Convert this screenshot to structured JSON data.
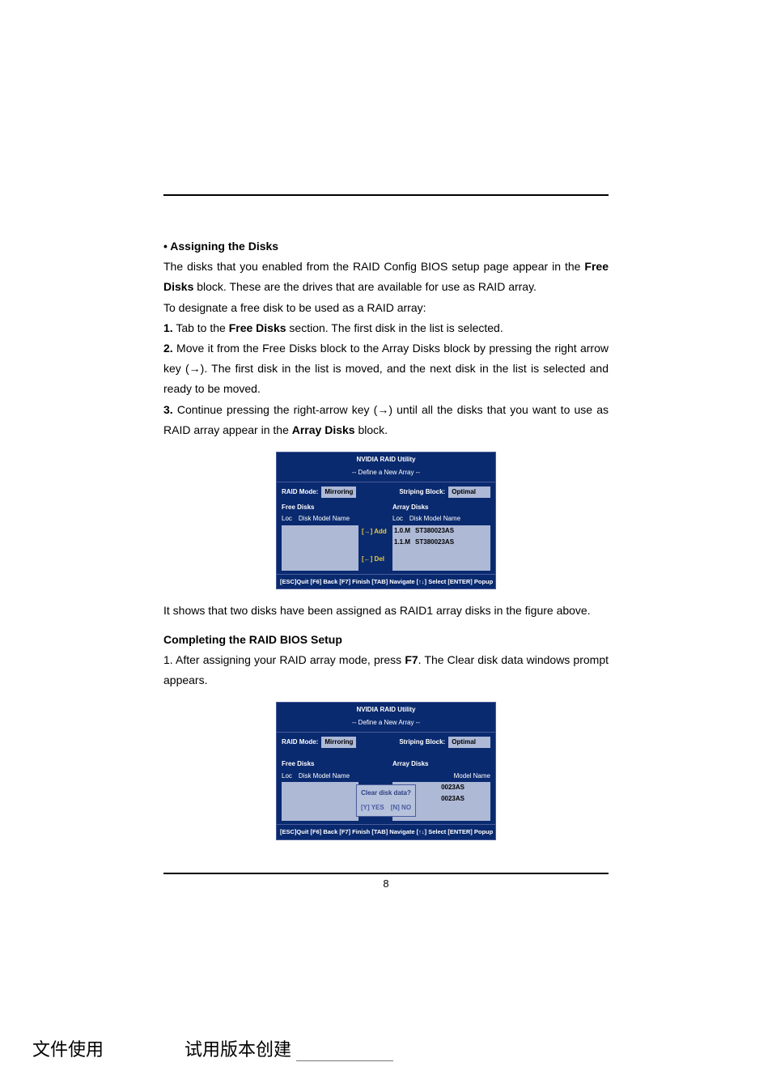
{
  "text": {
    "assigning_heading": "• Assigning the Disks",
    "p1": "The disks that you enabled from the RAID Config BIOS setup page appear in the ",
    "free_disks_bold": "Free Disks",
    "p1b": " block. These are the drives that are available for use as RAID array.",
    "p2": "To designate a free disk to be used as a RAID array:",
    "s1a": "1.",
    "s1b": " Tab to the ",
    "s1c": "Free Disks",
    "s1d": " section. The first disk in the list is selected.",
    "s2a": "2.",
    "s2b": " Move it from the Free Disks block to the Array Disks block by pressing the right arrow key (→). The first disk in the list is moved, and the next disk in the list is selected and ready to be moved.",
    "s3a": "3.",
    "s3b": " Continue pressing the right-arrow key (→) until all the disks that you want to use as RAID array appear in the ",
    "s3c": "Array Disks",
    "s3d": " block.",
    "caption1": "It shows that two disks have been assigned as RAID1 array disks in the figure above.",
    "completing_heading": "Completing the RAID BIOS Setup",
    "c1a": "1. After assigning your RAID array mode, press ",
    "c1b": "F7",
    "c1c": ". The Clear disk data windows prompt appears."
  },
  "bios": {
    "title": "NVIDIA RAID Utility",
    "subtitle": "--  Define a New Array  --",
    "raid_mode_label": "RAID Mode:",
    "raid_mode_value": "Mirroring",
    "striping_label": "Striping Block:",
    "striping_value": "Optimal",
    "free_disks_label": "Free Disks",
    "array_disks_label": "Array Disks",
    "col_loc": "Loc",
    "col_model": "Disk Model Name",
    "col_model_partial": "Model Name",
    "add_label": "[→] Add",
    "del_label": "[←] Del",
    "del_label2": "[→] Del",
    "rows": [
      {
        "loc": "1.0.M",
        "model": "ST380023AS"
      },
      {
        "loc": "1.1.M",
        "model": "ST380023AS"
      }
    ],
    "rows_partial": [
      "0023AS",
      "0023AS"
    ],
    "dialog_title": "Clear disk data?",
    "dialog_yes": "[Y] YES",
    "dialog_no": "[N] NO",
    "footer": "[ESC]Quit  [F6] Back  [F7] Finish  [TAB] Navigate  [↑↓] Select  [ENTER] Popup"
  },
  "page_number": "8",
  "trial": {
    "left": "文件使用",
    "mid": "试用版本创建"
  }
}
